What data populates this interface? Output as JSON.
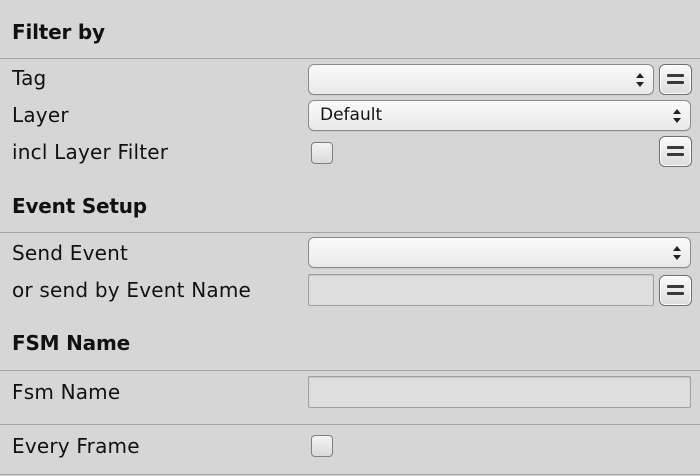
{
  "sections": {
    "filter_by": {
      "title": "Filter by",
      "tag_label": "Tag",
      "tag_value": "",
      "layer_label": "Layer",
      "layer_value": "Default",
      "incl_layer_filter_label": "incl Layer Filter",
      "incl_layer_filter_checked": false
    },
    "event_setup": {
      "title": "Event Setup",
      "send_event_label": "Send Event",
      "send_event_value": "",
      "event_name_label": "or send by Event Name",
      "event_name_value": ""
    },
    "fsm_name": {
      "title": "FSM Name",
      "fsm_name_label": "Fsm Name",
      "fsm_name_value": ""
    },
    "every_frame": {
      "label": "Every Frame",
      "checked": false
    }
  },
  "icons": {
    "dropdown_arrows": "updown-arrows-icon",
    "variable_toggle": "equals-icon"
  }
}
